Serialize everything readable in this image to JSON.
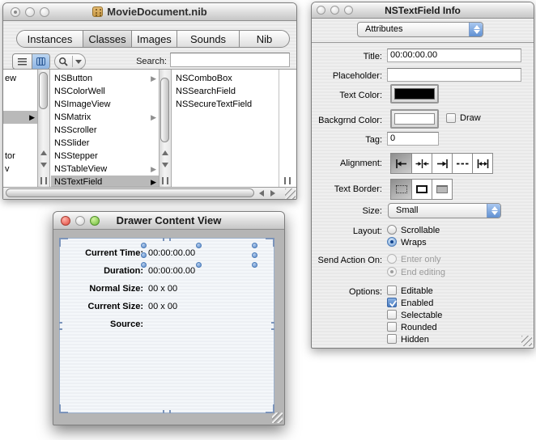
{
  "colors": {
    "accent_blue": "#3f76c0",
    "selection_grey": "#b9b9b9",
    "handle_blue": "#6f9ddc",
    "drawer_panel_border": "#9ab0cd",
    "text_color_well": "#000000",
    "bg_color_well": "#ffffff"
  },
  "nib_window": {
    "title": "MovieDocument.nib",
    "tabs": [
      {
        "label": "Instances",
        "active": false
      },
      {
        "label": "Classes",
        "active": true
      },
      {
        "label": "Images",
        "active": false
      },
      {
        "label": "Sounds",
        "active": false
      },
      {
        "label": "Nib",
        "active": false
      }
    ],
    "toolbar": {
      "search_label": "Search:",
      "search_value": ""
    },
    "browser": {
      "col1": [
        {
          "label": "ew"
        },
        {
          "label": "",
          "selected": true
        },
        {
          "label": "tor"
        },
        {
          "label": "v"
        }
      ],
      "col2": [
        {
          "label": "NSButton",
          "has_children": true
        },
        {
          "label": "NSColorWell",
          "has_children": false
        },
        {
          "label": "NSImageView",
          "has_children": false
        },
        {
          "label": "NSMatrix",
          "has_children": true
        },
        {
          "label": "NSScroller",
          "has_children": false
        },
        {
          "label": "NSSlider",
          "has_children": false
        },
        {
          "label": "NSStepper",
          "has_children": false
        },
        {
          "label": "NSTableView",
          "has_children": true
        },
        {
          "label": "NSTextField",
          "has_children": true,
          "selected": true
        }
      ],
      "col3": [
        {
          "label": "NSComboBox"
        },
        {
          "label": "NSSearchField"
        },
        {
          "label": "NSSecureTextField"
        }
      ]
    }
  },
  "drawer_window": {
    "title": "Drawer Content View",
    "rows": [
      {
        "label": "Current Time:",
        "value": "00:00:00.00",
        "selected": true
      },
      {
        "label": "Duration:",
        "value": "00:00:00.00",
        "selected": false
      },
      {
        "label": "Normal Size:",
        "value": "00 x 00",
        "selected": false
      },
      {
        "label": "Current Size:",
        "value": "00 x 00",
        "selected": false
      },
      {
        "label": "Source:",
        "value": "",
        "selected": false
      }
    ]
  },
  "inspector_window": {
    "title": "NSTextField Info",
    "pane_selector": "Attributes",
    "title_field": {
      "label": "Title:",
      "value": "00:00:00.00"
    },
    "placeholder_field": {
      "label": "Placeholder:",
      "value": ""
    },
    "text_color": {
      "label": "Text Color:",
      "color": "#000000"
    },
    "bg_color": {
      "label": "Backgrnd Color:",
      "color": "#ffffff",
      "draw_label": "Draw",
      "draw_checked": false
    },
    "tag_field": {
      "label": "Tag:",
      "value": "0"
    },
    "alignment": {
      "label": "Alignment:",
      "selected_index": 0
    },
    "text_border": {
      "label": "Text Border:",
      "selected_index": 0
    },
    "size": {
      "label": "Size:",
      "value": "Small"
    },
    "layout": {
      "label": "Layout:",
      "options": [
        {
          "label": "Scrollable",
          "selected": false
        },
        {
          "label": "Wraps",
          "selected": true
        }
      ]
    },
    "send_action": {
      "label": "Send Action On:",
      "options": [
        {
          "label": "Enter only",
          "selected": false,
          "disabled": true
        },
        {
          "label": "End editing",
          "selected": true,
          "disabled": true
        }
      ]
    },
    "options": {
      "label": "Options:",
      "items": [
        {
          "label": "Editable",
          "checked": false
        },
        {
          "label": "Enabled",
          "checked": true
        },
        {
          "label": "Selectable",
          "checked": false
        },
        {
          "label": "Rounded",
          "checked": false
        },
        {
          "label": "Hidden",
          "checked": false
        }
      ]
    }
  }
}
